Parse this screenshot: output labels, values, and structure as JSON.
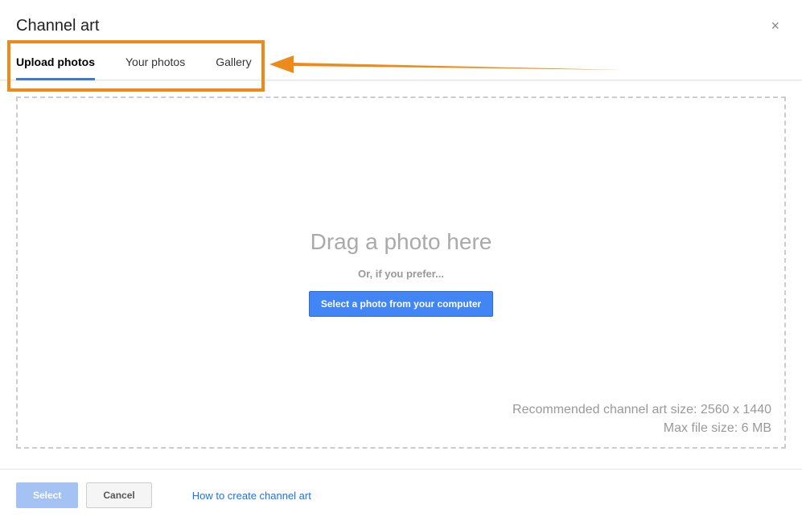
{
  "header": {
    "title": "Channel art",
    "close": "×"
  },
  "tabs": [
    {
      "label": "Upload photos",
      "active": true
    },
    {
      "label": "Your photos",
      "active": false
    },
    {
      "label": "Gallery",
      "active": false
    }
  ],
  "dropzone": {
    "drag_text": "Drag a photo here",
    "or_text": "Or, if you prefer...",
    "select_button": "Select a photo from your computer",
    "recommended_size": "Recommended channel art size: 2560 x 1440",
    "max_size": "Max file size: 6 MB"
  },
  "footer": {
    "select_label": "Select",
    "cancel_label": "Cancel",
    "help_link": "How to create channel art"
  },
  "annotation": {
    "highlight_color": "#ed8a19"
  }
}
